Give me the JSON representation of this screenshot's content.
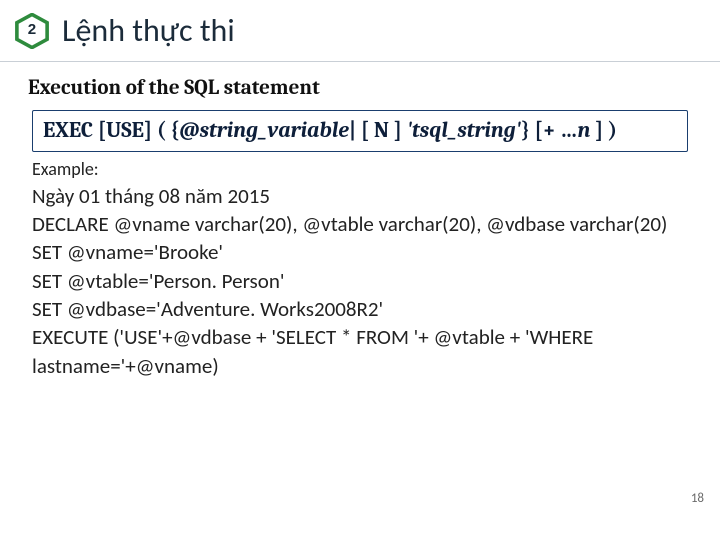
{
  "header": {
    "badge_number": "2",
    "title": "Lệnh thực thi"
  },
  "section_heading": "Execution of the SQL statement",
  "syntax": {
    "part1": "EXEC [USE] ( {",
    "var1": "@string_variable",
    "part2": "| [ N ] ",
    "var2": "'tsql_string'",
    "part3": "} [+ …",
    "var3": "n",
    "part4": " ] )"
  },
  "example_label": "Example:",
  "code_lines": [
    "Ngày 01 tháng 08 năm 2015",
    "DECLARE @vname varchar(20), @vtable varchar(20), @vdbase varchar(20)",
    "SET @vname='Brooke'",
    "SET @vtable='Person. Person'",
    "SET @vdbase='Adventure. Works2008R2'",
    "EXECUTE ('USE'+@vdbase + 'SELECT * FROM '+ @vtable + 'WHERE lastname='+@vname)"
  ],
  "page_number": "18"
}
